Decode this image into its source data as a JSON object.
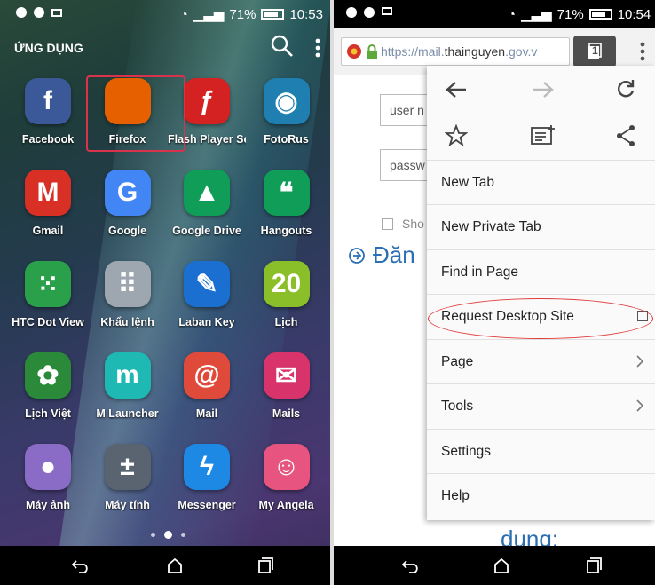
{
  "left": {
    "status": {
      "battery": "71%",
      "time": "10:53"
    },
    "header_title": "ỨNG DỤNG",
    "apps": [
      {
        "label": "Facebook",
        "icon": "facebook-icon",
        "color": "#3b5998"
      },
      {
        "label": "Firefox",
        "icon": "firefox-icon",
        "color": "#e66000"
      },
      {
        "label": "Flash Player Se",
        "icon": "flash-player-icon",
        "color": "#d42121"
      },
      {
        "label": "FotoRus",
        "icon": "fotorus-icon",
        "color": "#1e7fb0"
      },
      {
        "label": "Gmail",
        "icon": "gmail-icon",
        "color": "#d93025"
      },
      {
        "label": "Google",
        "icon": "google-icon",
        "color": "#4285f4"
      },
      {
        "label": "Google Drive",
        "icon": "google-drive-icon",
        "color": "#0f9d58"
      },
      {
        "label": "Hangouts",
        "icon": "hangouts-icon",
        "color": "#0f9d58"
      },
      {
        "label": "HTC Dot View",
        "icon": "htc-dot-view-icon",
        "color": "#2aa04a"
      },
      {
        "label": "Khẩu lệnh",
        "icon": "voice-command-icon",
        "color": "#9ea6b0"
      },
      {
        "label": "Laban Key",
        "icon": "laban-key-icon",
        "color": "#1a6fd1"
      },
      {
        "label": "Lịch",
        "icon": "calendar-icon",
        "color": "#8bbf2a"
      },
      {
        "label": "Lịch Việt",
        "icon": "lich-viet-icon",
        "color": "#2a8a3a"
      },
      {
        "label": "M Launcher",
        "icon": "m-launcher-icon",
        "color": "#1fb9b3"
      },
      {
        "label": "Mail",
        "icon": "mail-icon",
        "color": "#e04a3a"
      },
      {
        "label": "Mails",
        "icon": "mails-icon",
        "color": "#d8336a"
      },
      {
        "label": "Máy ảnh",
        "icon": "camera-icon",
        "color": "#8a6bc6"
      },
      {
        "label": "Máy tính",
        "icon": "calculator-icon",
        "color": "#5a6470"
      },
      {
        "label": "Messenger",
        "icon": "messenger-icon",
        "color": "#1e88e5"
      },
      {
        "label": "My Angela",
        "icon": "my-angela-icon",
        "color": "#e75480"
      }
    ],
    "calendar_day": "20"
  },
  "right": {
    "status": {
      "battery": "71%",
      "time": "10:54"
    },
    "url": {
      "scheme": "https://mail.",
      "host": "thainguyen",
      "rest": ".gov.v"
    },
    "tab_count": "1",
    "page": {
      "user_placeholder": "user n",
      "password_placeholder": "passw",
      "show_label": "Sho",
      "login_text": "Đăn",
      "footer_text": "dung:"
    },
    "menu": {
      "items": [
        {
          "label": "New Tab"
        },
        {
          "label": "New Private Tab"
        },
        {
          "label": "Find in Page"
        },
        {
          "label": "Request Desktop Site"
        },
        {
          "label": "Page"
        },
        {
          "label": "Tools"
        },
        {
          "label": "Settings"
        },
        {
          "label": "Help"
        }
      ]
    }
  },
  "colors": {
    "highlight": "#d8334a",
    "link": "#2a6fb3"
  }
}
